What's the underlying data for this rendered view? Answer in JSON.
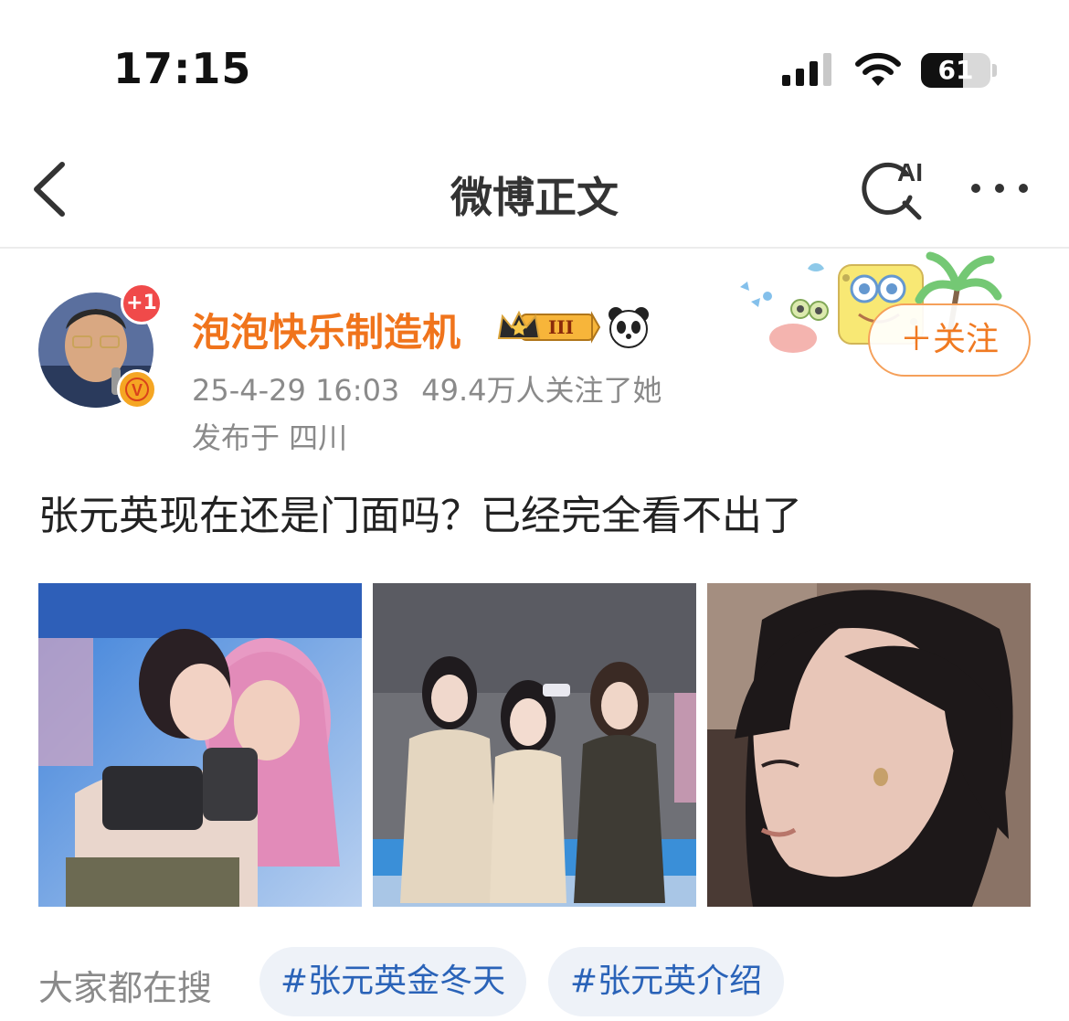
{
  "status_bar": {
    "time": "17:15",
    "battery_level": "61",
    "battery_fraction": 0.61,
    "icons": [
      "signal-icon",
      "wifi-icon",
      "battery-icon"
    ]
  },
  "nav": {
    "title": "微博正文",
    "back_icon": "chevron-left-icon",
    "ai_search_label": "AI",
    "more_icon": "more-horizontal-icon"
  },
  "author": {
    "name": "泡泡快乐制造机",
    "level_badge": "III",
    "plus_badge": "+1",
    "verified_mark": "V",
    "timestamp": "25-4-29 16:03",
    "followers": "49.4万人关注了她",
    "location": "发布于 四川",
    "follow_label": "＋关注"
  },
  "post": {
    "text": "张元英现在还是门面吗？已经完全看不出了",
    "images": [
      "photo-1",
      "photo-2",
      "photo-3"
    ]
  },
  "trending": {
    "label": "大家都在搜",
    "tags": [
      "#张元英金冬天",
      "#张元英介绍"
    ]
  },
  "colors": {
    "accent_orange": "#f07a22",
    "hashtag_blue": "#2a63b8",
    "chip_bg": "#eef2f8",
    "meta_gray": "#8a8a8a"
  }
}
